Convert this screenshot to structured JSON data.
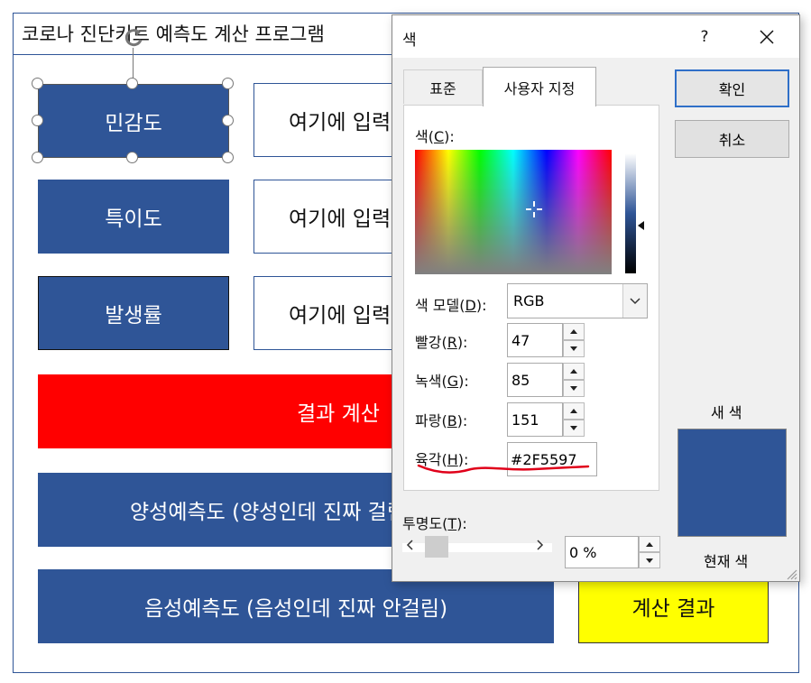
{
  "slide": {
    "title": "코로나 진단키트 예측도 계산 프로그램",
    "labels": [
      "민감도",
      "특이도",
      "발생률"
    ],
    "inputs": [
      "여기에 입력",
      "여기에 입력",
      "여기에 입력"
    ],
    "calc_button": "결과 계산",
    "ppv": "양성예측도 (양성인데 진짜 걸림)",
    "npv": "음성예측도 (음성인데 진짜 안걸림)",
    "result": "계산 결과",
    "box_color": "#2F5597",
    "calc_color": "#FF0000",
    "result_color": "#FFFF00"
  },
  "dialog": {
    "title": "색",
    "help": "?",
    "tabs": [
      {
        "label": "표준",
        "active": false
      },
      {
        "label": "사용자 지정",
        "active": true
      }
    ],
    "color_label": "색(C):",
    "color_label_key": "C",
    "model_label_pre": "색 모델(",
    "model_label_key": "D",
    "model_label_post": "):",
    "model_value": "RGB",
    "red_pre": "빨강(",
    "red_key": "R",
    "red_value": "47",
    "green_pre": "녹색(",
    "green_key": "G",
    "green_value": "85",
    "blue_pre": "파랑(",
    "blue_key": "B",
    "blue_value": "151",
    "hex_pre": "육각(",
    "hex_key": "H",
    "hex_value": "#2F5597",
    "transparency_pre": "투명도(",
    "transparency_key": "T",
    "transparency_value": "0 %",
    "ok": "확인",
    "cancel": "취소",
    "new_color": "새 색",
    "current_color": "현재 색",
    "selected_color": "#2F5597"
  }
}
